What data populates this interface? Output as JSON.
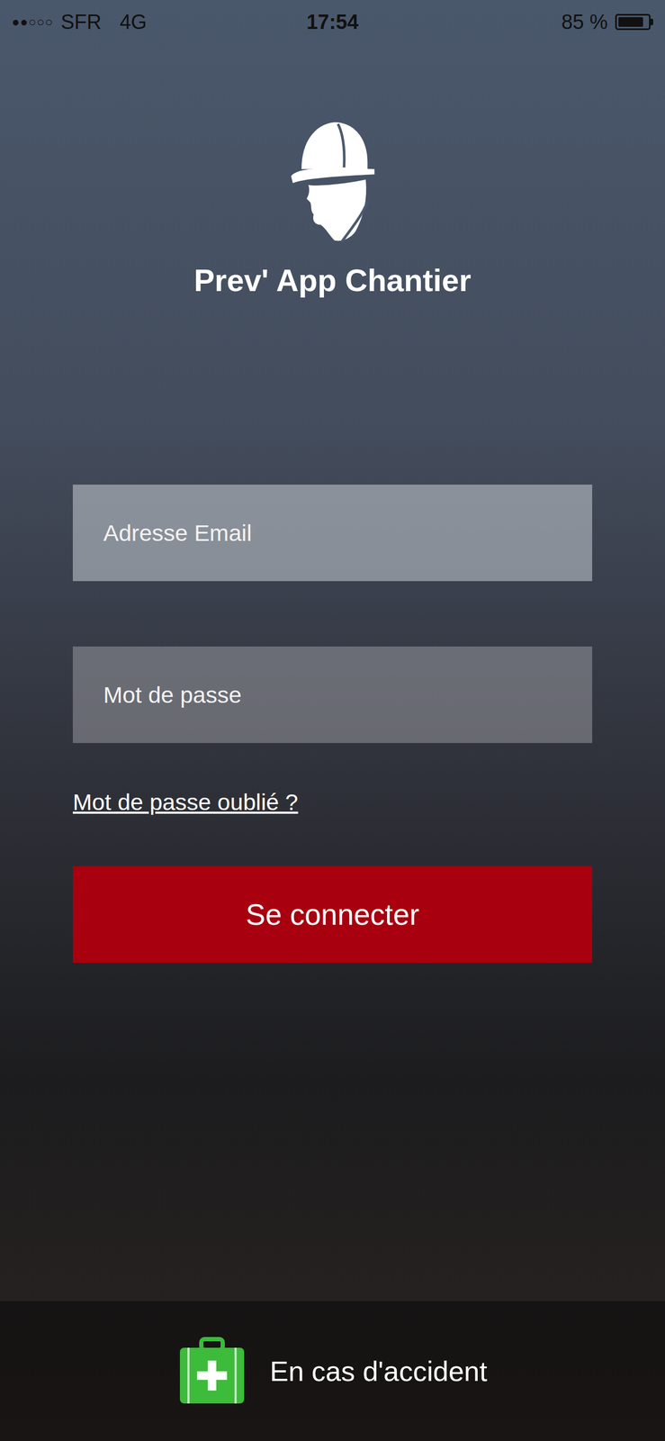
{
  "status_bar": {
    "signal": "●●○○○",
    "carrier": "SFR",
    "network": "4G",
    "time": "17:54",
    "battery": "85 %",
    "battery_level": 0.85
  },
  "app": {
    "title": "Prev' App Chantier"
  },
  "form": {
    "fields": [
      {
        "placeholder": "Adresse Email",
        "kind": "email"
      },
      {
        "placeholder": "Mot de passe",
        "kind": "password"
      }
    ],
    "forgot_link": "Mot de passe oublié ?",
    "submit": "Se connecter"
  },
  "emergency": {
    "label": "En cas d'accident"
  }
}
